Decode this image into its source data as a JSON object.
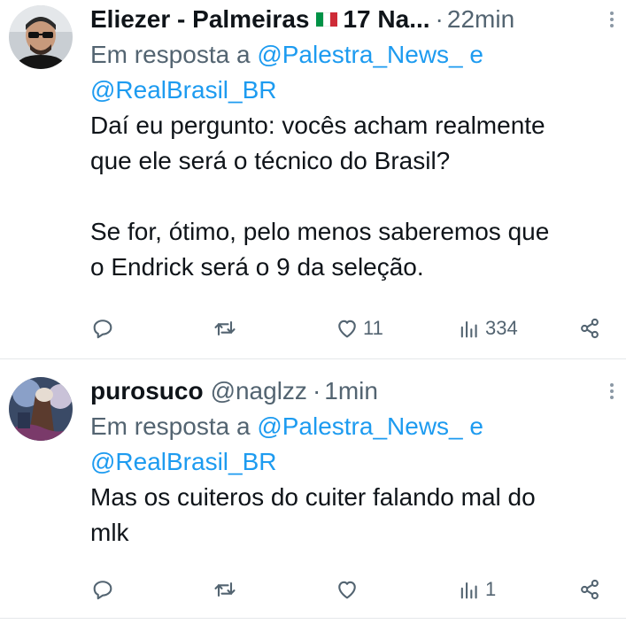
{
  "tweets": [
    {
      "author_name": "Eliezer - Palmeiras",
      "name_suffix": "17 Na...",
      "handle": "",
      "separator": "·",
      "time": "22min",
      "reply_prefix": "Em resposta a",
      "reply_mentions_line1": "@Palestra_News_ e",
      "reply_mentions_line2": "@RealBrasil_BR",
      "text": "Daí eu pergunto: vocês acham realmente\nque ele será o técnico do Brasil?\n\nSe for, ótimo, pelo menos saberemos que\no Endrick será o 9 da seleção.",
      "stats": {
        "replies": "",
        "retweets": "",
        "likes": "11",
        "views": "334"
      }
    },
    {
      "author_name": "purosuco",
      "name_suffix": "",
      "handle": "@naglzz",
      "separator": "·",
      "time": "1min",
      "reply_prefix": "Em resposta a",
      "reply_mentions_line1": "@Palestra_News_ e",
      "reply_mentions_line2": "@RealBrasil_BR",
      "text": "Mas os cuiteros do cuiter falando mal do\nmlk",
      "stats": {
        "replies": "",
        "retweets": "",
        "likes": "",
        "views": "1"
      }
    }
  ],
  "icons": {
    "reply": "reply-icon",
    "retweet": "retweet-icon",
    "like": "heart-icon",
    "views": "views-icon",
    "share": "share-icon",
    "more": "more-icon",
    "flag": "italy-flag-icon"
  },
  "colors": {
    "text": "#0f1419",
    "secondary": "#536471",
    "link": "#1d9bf0",
    "divider": "#e5e7ea",
    "flag_green": "#009246",
    "flag_white": "#ffffff",
    "flag_red": "#ce2b37"
  }
}
